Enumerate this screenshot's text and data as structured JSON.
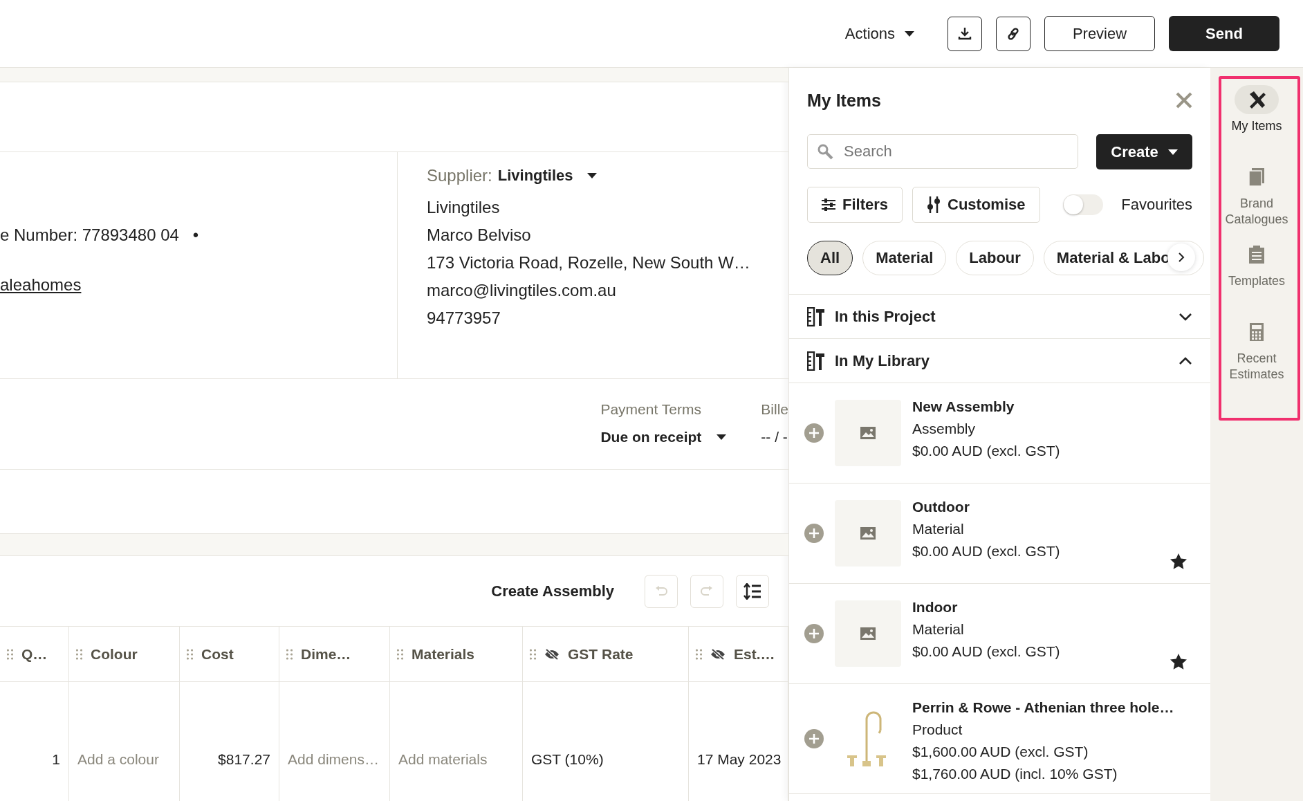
{
  "top_bar": {
    "actions": "Actions",
    "icon_buttons": [
      {
        "kind": "download"
      },
      {
        "kind": "link"
      }
    ],
    "preview": "Preview",
    "send": "Send"
  },
  "contact": {
    "left_lines": [
      "e Number: 77893480 04"
    ],
    "bullet": "•",
    "link": "aleahomes",
    "supplier_label": "Supplier:",
    "supplier_value": "Livingtiles",
    "supplier_lines": [
      "Livingtiles",
      "Marco Belviso",
      "173 Victoria Road, Rozelle, New South W…",
      "marco@livingtiles.com.au",
      "94773957"
    ]
  },
  "payment": {
    "fields": [
      {
        "label": "Payment Terms",
        "value": "Due on receipt",
        "kind": "dropdown"
      },
      {
        "label": "Bille",
        "value": "-- / -",
        "kind": "text"
      }
    ]
  },
  "table": {
    "create_assembly": "Create Assembly",
    "tools": [
      {
        "kind": "undo",
        "disabled": true
      },
      {
        "kind": "redo",
        "disabled": true
      },
      {
        "kind": "spacing",
        "disabled": false
      }
    ],
    "columns": [
      {
        "label": "Q…",
        "hidden": false
      },
      {
        "label": "Colour",
        "hidden": false
      },
      {
        "label": "Cost",
        "hidden": false
      },
      {
        "label": "Dime…",
        "hidden": false
      },
      {
        "label": "Materials",
        "hidden": false
      },
      {
        "label": "GST Rate",
        "hidden": true
      },
      {
        "label": "Est.…",
        "hidden": true
      }
    ],
    "rows": [
      {
        "cells": [
          {
            "text": "1",
            "placeholder": false
          },
          {
            "text": "Add a colour",
            "placeholder": true
          },
          {
            "text": "$817.27",
            "placeholder": false
          },
          {
            "text": "Add dimens…",
            "placeholder": true
          },
          {
            "text": "Add materials",
            "placeholder": true
          },
          {
            "text": "GST (10%)",
            "placeholder": false
          },
          {
            "text": "17 May 2023",
            "placeholder": false
          }
        ]
      }
    ]
  },
  "panel": {
    "title": "My Items",
    "search": {
      "placeholder": "Search"
    },
    "create": "Create",
    "filters": "Filters",
    "customise": "Customise",
    "favourites": {
      "label": "Favourites",
      "on": false
    },
    "chips": [
      {
        "label": "All",
        "selected": true
      },
      {
        "label": "Material",
        "selected": false
      },
      {
        "label": "Labour",
        "selected": false
      },
      {
        "label": "Material & Labo",
        "selected": false
      }
    ],
    "sections": [
      {
        "title": "In this Project",
        "expanded": false
      },
      {
        "title": "In My Library",
        "expanded": true
      }
    ],
    "items": [
      {
        "name": "New Assembly",
        "type": "Assembly",
        "prices": [
          "$0.00 AUD (excl. GST)"
        ],
        "favourite": false,
        "kind": "placeholder"
      },
      {
        "name": "Outdoor",
        "type": "Material",
        "prices": [
          "$0.00 AUD (excl. GST)"
        ],
        "favourite": true,
        "kind": "placeholder"
      },
      {
        "name": "Indoor",
        "type": "Material",
        "prices": [
          "$0.00 AUD (excl. GST)"
        ],
        "favourite": true,
        "kind": "placeholder"
      },
      {
        "name": "Perrin & Rowe - Athenian three hole…",
        "type": "Product",
        "prices": [
          "$1,600.00 AUD (excl. GST)",
          "$1,760.00 AUD (incl. 10% GST)"
        ],
        "favourite": false,
        "kind": "photo"
      }
    ]
  },
  "sidebar": {
    "items": [
      {
        "label": "My Items",
        "selected": true
      },
      {
        "label": "Brand Catalogues",
        "selected": false
      },
      {
        "label": "Templates",
        "selected": false
      },
      {
        "label": "Recent Estimates",
        "selected": false
      }
    ]
  }
}
